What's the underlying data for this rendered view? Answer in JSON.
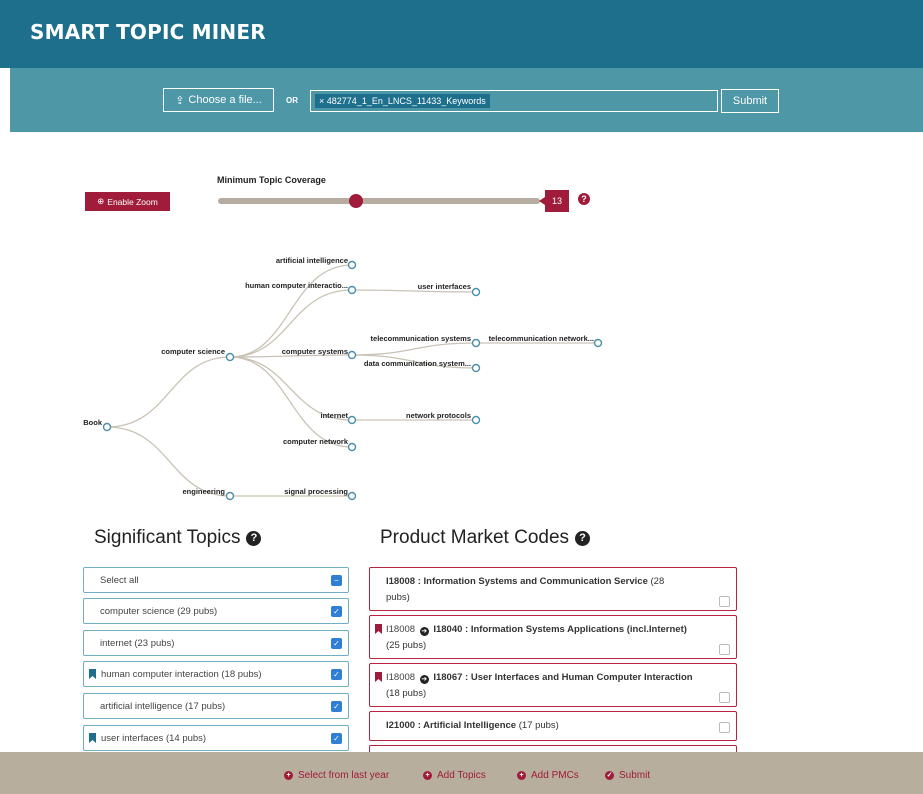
{
  "header": {
    "title": "SMART TOPIC MINER"
  },
  "upload": {
    "choose_label": "Choose a file...",
    "or_label": "OR",
    "file_token": "482774_1_En_LNCS_11433_Keywords",
    "submit_label": "Submit"
  },
  "coverage": {
    "zoom_label": "Enable Zoom",
    "title": "Minimum Topic Coverage",
    "value": "13",
    "level_fraction": 0.43,
    "help": "?"
  },
  "tree": {
    "nodes": {
      "book": "Book",
      "cs": "computer science",
      "eng": "engineering",
      "ai": "artificial intelligence",
      "hci": "human computer interactio...",
      "cs_sys": "computer systems",
      "internet": "internet",
      "comp_net": "computer network",
      "ui": "user interfaces",
      "telecom_sys": "telecommunication systems",
      "datacomm": "data communication system...",
      "telecom_net": "telecommunication network...",
      "net_proto": "network protocols",
      "signal": "signal processing"
    }
  },
  "significant_topics": {
    "title": "Significant Topics",
    "select_all": "Select all",
    "items": [
      {
        "label": "computer science (29 pubs)",
        "bookmark": false
      },
      {
        "label": "internet (23 pubs)",
        "bookmark": false
      },
      {
        "label": "human computer interaction (18 pubs)",
        "bookmark": true
      },
      {
        "label": "artificial intelligence (17 pubs)",
        "bookmark": false
      },
      {
        "label": "user interfaces (14 pubs)",
        "bookmark": true
      }
    ]
  },
  "pmc": {
    "title": "Product Market Codes",
    "items": [
      {
        "code": "I18008 : Information Systems and Communication Service",
        "pubs_a": " (28",
        "pubs_b": "pubs)"
      },
      {
        "parent": "I18008",
        "code": "I18040 : Information Systems Applications (incl.Internet)",
        "pubs": "(25 pubs)"
      },
      {
        "parent": "I18008",
        "code": "I18067 : User Interfaces and Human Computer Interaction",
        "pubs": "(18 pubs)"
      },
      {
        "code": "I21000 : Artificial Intelligence",
        "pubs": " (17 pubs)"
      }
    ]
  },
  "footer": {
    "last_year": "Select from last year",
    "add_topics": "Add Topics",
    "add_pmcs": "Add PMCs",
    "submit": "Submit"
  },
  "colors": {
    "header": "#1d6f8c",
    "subbar": "#4e97a7",
    "accent": "#a01c3a",
    "footer": "#b8ae9e"
  }
}
